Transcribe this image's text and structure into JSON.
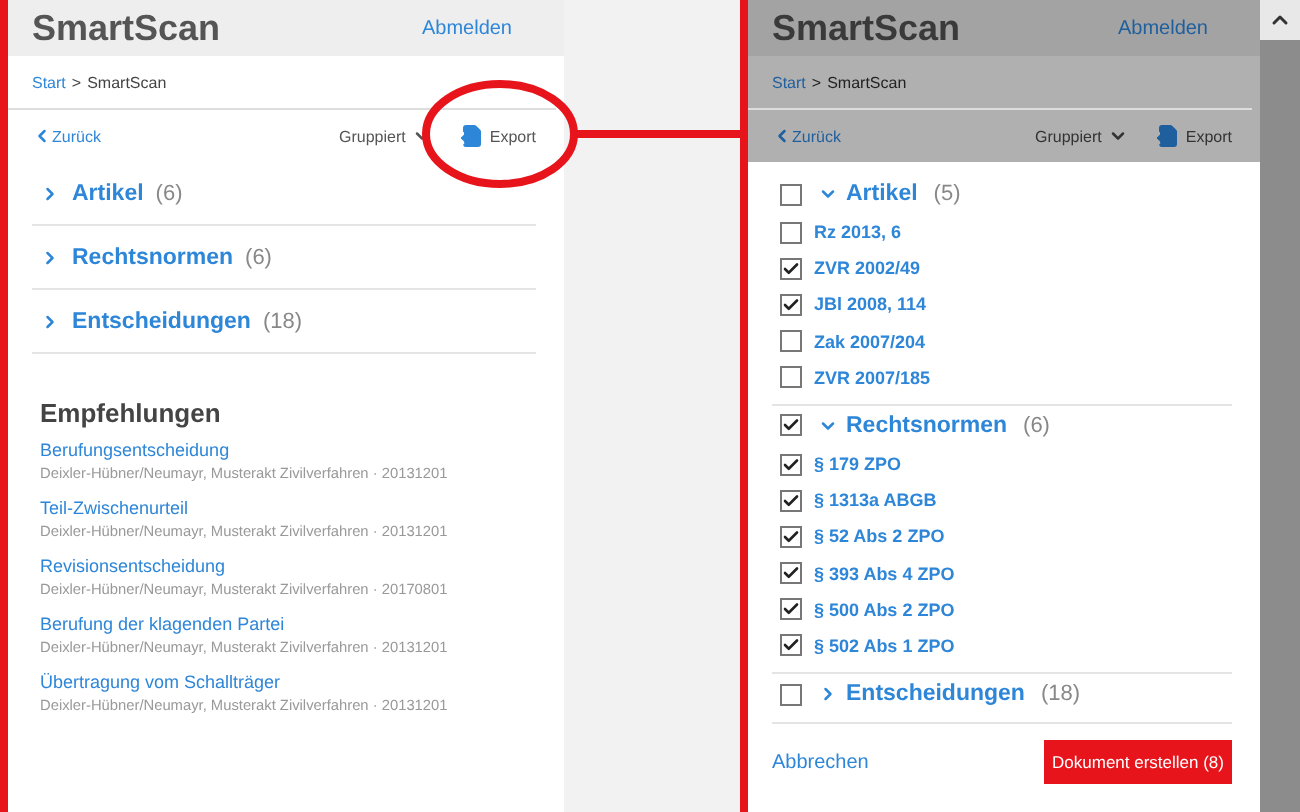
{
  "left": {
    "header": {
      "title": "SmartScan",
      "logout": "Abmelden"
    },
    "breadcrumb": {
      "link": "Start",
      "separator": ">",
      "current": "SmartScan"
    },
    "toolbar": {
      "back": "Zurück",
      "grouping": "Gruppiert",
      "export": "Export"
    },
    "groups": [
      {
        "label": "Artikel",
        "count": "(6)",
        "expanded": false
      },
      {
        "label": "Rechtsnormen",
        "count": "(6)",
        "expanded": false
      },
      {
        "label": "Entscheidungen",
        "count": "(18)",
        "expanded": false
      }
    ],
    "recommendations": {
      "title": "Empfehlungen",
      "items": [
        {
          "title": "Berufungsentscheidung",
          "meta": "Deixler-Hübner/Neumayr, Musterakt Zivilverfahren · 20131201"
        },
        {
          "title": "Teil-Zwischenurteil",
          "meta": "Deixler-Hübner/Neumayr, Musterakt Zivilverfahren · 20131201"
        },
        {
          "title": "Revisionsentscheidung",
          "meta": "Deixler-Hübner/Neumayr, Musterakt Zivilverfahren · 20170801"
        },
        {
          "title": "Berufung der klagenden Partei",
          "meta": "Deixler-Hübner/Neumayr, Musterakt Zivilverfahren · 20131201"
        },
        {
          "title": "Übertragung vom Schallträger",
          "meta": "Deixler-Hübner/Neumayr, Musterakt Zivilverfahren · 20131201"
        }
      ]
    }
  },
  "right": {
    "dimmed": true,
    "header": {
      "title": "SmartScan",
      "logout": "Abmelden"
    },
    "breadcrumb": {
      "link": "Start",
      "separator": ">",
      "current": "SmartScan"
    },
    "toolbar": {
      "back": "Zurück",
      "grouping": "Gruppiert",
      "export": "Export"
    },
    "groups": [
      {
        "label": "Artikel",
        "count": "(5)",
        "expanded": true,
        "checked": false,
        "items": [
          {
            "label": "Rz 2013, 6",
            "checked": false
          },
          {
            "label": "ZVR 2002/49",
            "checked": true
          },
          {
            "label": "JBl 2008, 114",
            "checked": true
          },
          {
            "label": "Zak 2007/204",
            "checked": false
          },
          {
            "label": "ZVR 2007/185",
            "checked": false
          }
        ]
      },
      {
        "label": "Rechtsnormen",
        "count": "(6)",
        "expanded": true,
        "checked": true,
        "items": [
          {
            "label": "§ 179 ZPO",
            "checked": true
          },
          {
            "label": "§ 1313a ABGB",
            "checked": true
          },
          {
            "label": "§ 52 Abs 2 ZPO",
            "checked": true
          },
          {
            "label": "§ 393 Abs 4 ZPO",
            "checked": true
          },
          {
            "label": "§ 500 Abs 2 ZPO",
            "checked": true
          },
          {
            "label": "§ 502 Abs 1 ZPO",
            "checked": true
          }
        ]
      },
      {
        "label": "Entscheidungen",
        "count": "(18)",
        "expanded": false,
        "checked": false
      }
    ],
    "footer": {
      "cancel": "Abbrechen",
      "submit": "Dokument erstellen (8)"
    }
  }
}
